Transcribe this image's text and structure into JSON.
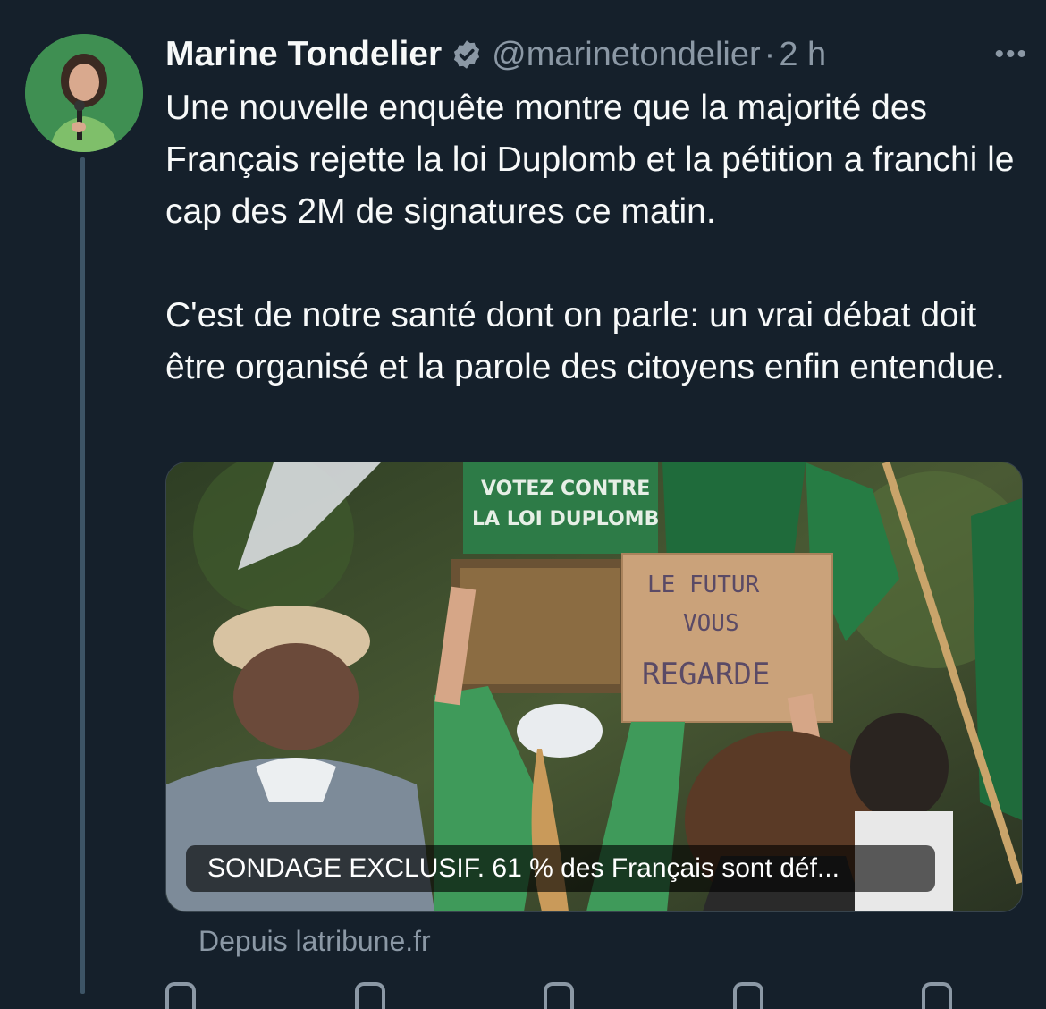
{
  "tweet": {
    "author_name": "Marine Tondelier",
    "handle": "@marinetondelier",
    "separator": "·",
    "time": "2 h",
    "more_label": "•••",
    "paragraphs": [
      "Une nouvelle enquête montre que la majorité des Français rejette la loi Duplomb et la pétition a franchi le cap des 2M de signatures ce matin.",
      "C'est de notre santé dont on parle: un vrai débat doit être organisé et la parole des citoyens enfin entendue."
    ]
  },
  "card": {
    "caption": "SONDAGE EXCLUSIF. 61 % des Français sont déf...",
    "sign_green_line1": "VOTEZ CONTRE",
    "sign_green_line2": "LA LOI DUPLOMB",
    "sign_cardboard_line1": "LE FUTUR",
    "sign_cardboard_line2": "VOUS",
    "sign_cardboard_line3": "REGARDE",
    "source": "Depuis latribune.fr"
  },
  "icons": [
    "verified-badge-icon",
    "more-icon",
    "reply-icon",
    "retweet-icon",
    "like-icon",
    "views-icon",
    "bookmark-icon"
  ],
  "colors": {
    "background": "#15202b",
    "text_primary": "#f7f9f9",
    "text_secondary": "#8b98a5",
    "thread_line": "#3d5466"
  }
}
